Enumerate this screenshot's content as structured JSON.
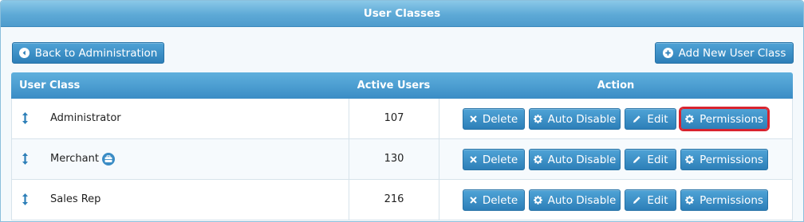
{
  "panel": {
    "title": "User Classes"
  },
  "toolbar": {
    "back_label": "Back to Administration",
    "add_label": "Add New User Class"
  },
  "grid": {
    "columns": [
      "User Class",
      "Active Users",
      "Action"
    ],
    "rows": [
      {
        "name": "Administrator",
        "active_users": "107",
        "badge": false,
        "permissions_selected": true
      },
      {
        "name": "Merchant",
        "active_users": "130",
        "badge": true,
        "badge_icon": "briefcase-icon"
      },
      {
        "name": "Sales Rep",
        "active_users": "216",
        "badge": false
      }
    ],
    "actions": {
      "delete": "Delete",
      "auto_disable": "Auto Disable",
      "edit": "Edit",
      "permissions": "Permissions"
    }
  },
  "colors": {
    "header_blue": "#5da9d6",
    "button_blue": "#2d7fb8",
    "selected_outline": "#d9232e"
  }
}
